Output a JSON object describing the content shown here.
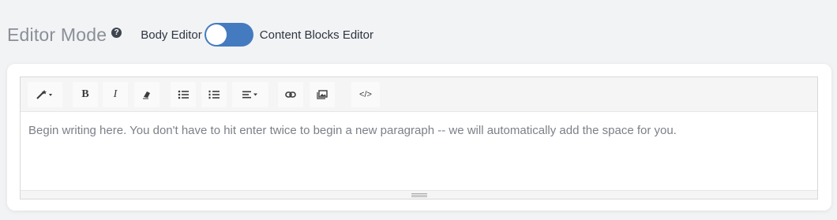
{
  "header": {
    "title": "Editor Mode",
    "help_icon": "question-circle-icon",
    "left_label": "Body Editor",
    "right_label": "Content Blocks Editor",
    "toggle_on": true
  },
  "toolbar": {
    "style_icon": "magic-wand-icon",
    "bold_label": "B",
    "italic_label": "I",
    "eraser_icon": "eraser-icon",
    "ul_icon": "unordered-list-icon",
    "ol_icon": "ordered-list-icon",
    "align_icon": "align-icon",
    "link_icon": "link-icon",
    "picture_icon": "picture-icon",
    "code_label": "</>"
  },
  "editor": {
    "placeholder": "Begin writing here. You don't have to hit enter twice to begin a new paragraph -- we will automatically add the space for you."
  },
  "colors": {
    "accent": "#447bc0",
    "background": "#f2f3f5"
  }
}
